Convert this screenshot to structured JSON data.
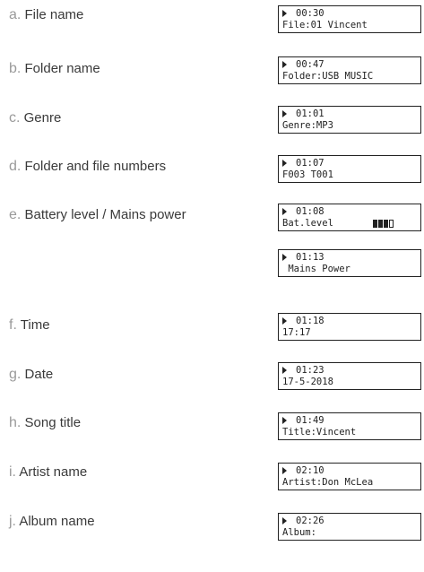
{
  "items": [
    {
      "letter": "a.",
      "label": "File name",
      "displays": [
        {
          "time": "00:30",
          "line2": "File:01 Vincent"
        }
      ]
    },
    {
      "letter": "b.",
      "label": "Folder name",
      "displays": [
        {
          "time": "00:47",
          "line2": "Folder:USB MUSIC"
        }
      ]
    },
    {
      "letter": "c.",
      "label": "Genre",
      "displays": [
        {
          "time": "01:01",
          "line2": "Genre:MP3"
        }
      ]
    },
    {
      "letter": "d.",
      "label": "Folder and file numbers",
      "displays": [
        {
          "time": "01:07",
          "line2": "F003 T001"
        }
      ]
    },
    {
      "letter": "e.",
      "label": "Battery level / Mains power",
      "displays": [
        {
          "time": "01:08",
          "line2": "Bat.level",
          "battery_level": 0.75
        },
        {
          "time": "01:13",
          "line2": " Mains Power"
        }
      ]
    },
    {
      "letter": "f.",
      "label": "Time",
      "displays": [
        {
          "time": "01:18",
          "line2": "17:17"
        }
      ]
    },
    {
      "letter": "g.",
      "label": "Date",
      "displays": [
        {
          "time": "01:23",
          "line2": "17-5-2018"
        }
      ]
    },
    {
      "letter": "h.",
      "label": "Song title",
      "displays": [
        {
          "time": "01:49",
          "line2": "Title:Vincent"
        }
      ]
    },
    {
      "letter": "i.",
      "label": "Artist name",
      "displays": [
        {
          "time": "02:10",
          "line2": "Artist:Don McLea"
        }
      ]
    },
    {
      "letter": "j.",
      "label": "Album name",
      "displays": [
        {
          "time": "02:26",
          "line2": "Album:"
        }
      ]
    }
  ],
  "icons": {
    "play": "play-icon",
    "battery": "battery-icon"
  }
}
